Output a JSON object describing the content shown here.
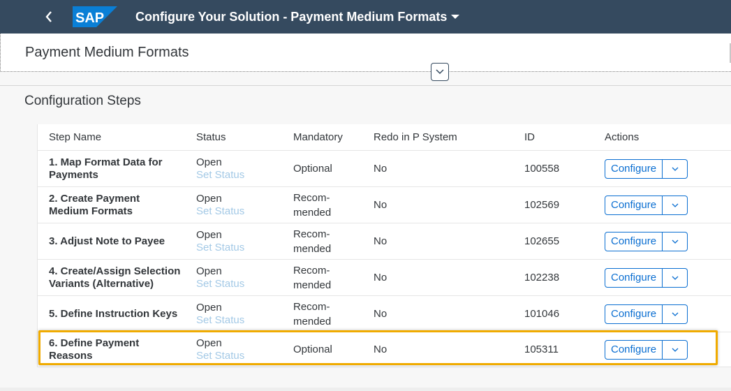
{
  "shell": {
    "logo_text": "SAP",
    "title": "Configure Your Solution - Payment Medium Formats",
    "colors": {
      "background": "#354a5f",
      "logo": "#0a7fd6",
      "title": "#ffffff"
    },
    "icons": {
      "back": "chevron-left-icon",
      "title_menu": "caret-down-icon"
    }
  },
  "object_header": {
    "title": "Payment Medium Formats",
    "collapse_icon": "chevron-down-icon"
  },
  "section": {
    "title": "Configuration Steps"
  },
  "table": {
    "columns": [
      "Step Name",
      "Status",
      "Mandatory",
      "Redo in P System",
      "ID",
      "Actions"
    ],
    "rows": [
      {
        "step": "1. Map Format Data for Payments",
        "status": "Open",
        "set_status": "Set Status",
        "mandatory": "Optional",
        "redo": "No",
        "id": "100558",
        "action": "Configure"
      },
      {
        "step": "2. Create Payment Medium Formats",
        "status": "Open",
        "set_status": "Set Status",
        "mandatory": "Recom-\nmended",
        "redo": "No",
        "id": "102569",
        "action": "Configure"
      },
      {
        "step": "3. Adjust Note to Payee",
        "status": "Open",
        "set_status": "Set Status",
        "mandatory": "Recom-\nmended",
        "redo": "No",
        "id": "102655",
        "action": "Configure"
      },
      {
        "step": "4. Create/Assign Selection Variants (Alternative)",
        "status": "Open",
        "set_status": "Set Status",
        "mandatory": "Recom-\nmended",
        "redo": "No",
        "id": "102238",
        "action": "Configure"
      },
      {
        "step": "5. Define Instruction Keys",
        "status": "Open",
        "set_status": "Set Status",
        "mandatory": "Recom-\nmended",
        "redo": "No",
        "id": "101046",
        "action": "Configure"
      },
      {
        "step": "6. Define Payment Reasons",
        "status": "Open",
        "set_status": "Set Status",
        "mandatory": "Optional",
        "redo": "No",
        "id": "105311",
        "action": "Configure"
      }
    ],
    "highlighted_row": 6,
    "colors": {
      "highlight": "#f0ab00",
      "link": "#a3c9e6",
      "button": "#0a6ed1"
    }
  }
}
